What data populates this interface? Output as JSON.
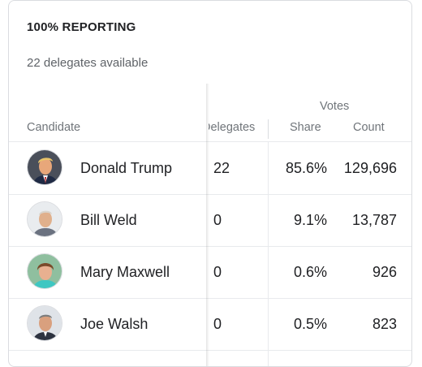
{
  "header": {
    "reporting": "100% REPORTING",
    "delegates_available": "22 delegates available"
  },
  "columns": {
    "candidate": "Candidate",
    "delegates": "Delegates",
    "votes_group": "Votes",
    "share": "Share",
    "count": "Count"
  },
  "rows": [
    {
      "name": "Donald Trump",
      "delegates": "22",
      "share": "85.6%",
      "count": "129,696",
      "avatar": "candidate-photo"
    },
    {
      "name": "Bill Weld",
      "delegates": "0",
      "share": "9.1%",
      "count": "13,787",
      "avatar": "candidate-photo"
    },
    {
      "name": "Mary Maxwell",
      "delegates": "0",
      "share": "0.6%",
      "count": "926",
      "avatar": "candidate-photo"
    },
    {
      "name": "Joe Walsh",
      "delegates": "0",
      "share": "0.5%",
      "count": "823",
      "avatar": "candidate-photo"
    }
  ]
}
